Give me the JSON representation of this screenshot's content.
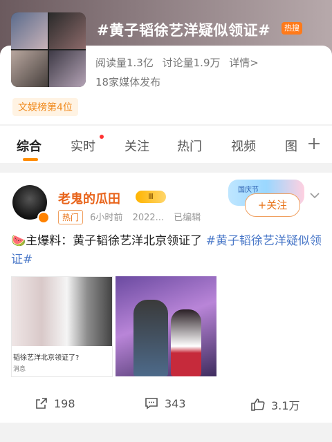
{
  "topic": {
    "title": "#黄子韬徐艺洋疑似领证#",
    "hot_badge": "热搜",
    "reads": "阅读量1.3亿",
    "discussions": "讨论量1.9万",
    "details": "详情>",
    "media": "18家媒体发布",
    "rank": "文娱榜第4位"
  },
  "tabs": [
    {
      "label": "综合",
      "active": true
    },
    {
      "label": "实时",
      "has_dot": true
    },
    {
      "label": "关注"
    },
    {
      "label": "热门"
    },
    {
      "label": "视频"
    },
    {
      "label": "图"
    }
  ],
  "post": {
    "author": "老鬼的瓜田",
    "level": "Ⅲ",
    "hot_tag": "热门",
    "time": "6小时前",
    "date": "2022...",
    "edited": "已编辑",
    "follow": "+关注",
    "follow_deco": "国庆节",
    "text_prefix": "🍉主爆料：黄子韬徐艺洋北京领证了 ",
    "text_topic": "#黄子韬徐艺洋疑似领证#",
    "image1_caption": "韬徐艺洋北京领证了?",
    "image1_source": "消息",
    "reposts": "198",
    "comments": "343",
    "likes": "3.1万"
  },
  "colors": {
    "accent": "#ff8c00",
    "author": "#e8641b",
    "link": "#4a78c8"
  }
}
